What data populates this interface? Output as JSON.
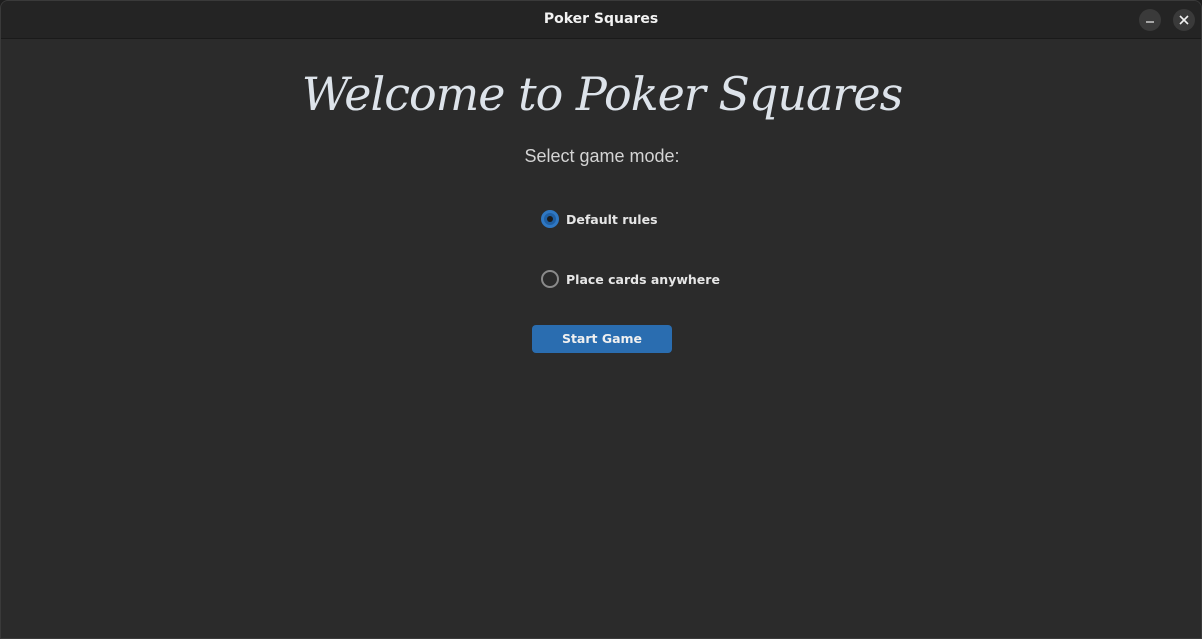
{
  "window": {
    "title": "Poker Squares"
  },
  "main": {
    "heading": "Welcome to Poker Squares",
    "prompt": "Select game mode:",
    "modes": [
      {
        "label": "Default rules",
        "selected": true
      },
      {
        "label": "Place cards anywhere",
        "selected": false
      }
    ],
    "start_button": "Start Game"
  },
  "colors": {
    "accent": "#2a6db0",
    "background": "#2b2b2b",
    "titlebar": "#242424"
  },
  "icons": {
    "minimize": "minimize-icon",
    "close": "close-icon"
  }
}
